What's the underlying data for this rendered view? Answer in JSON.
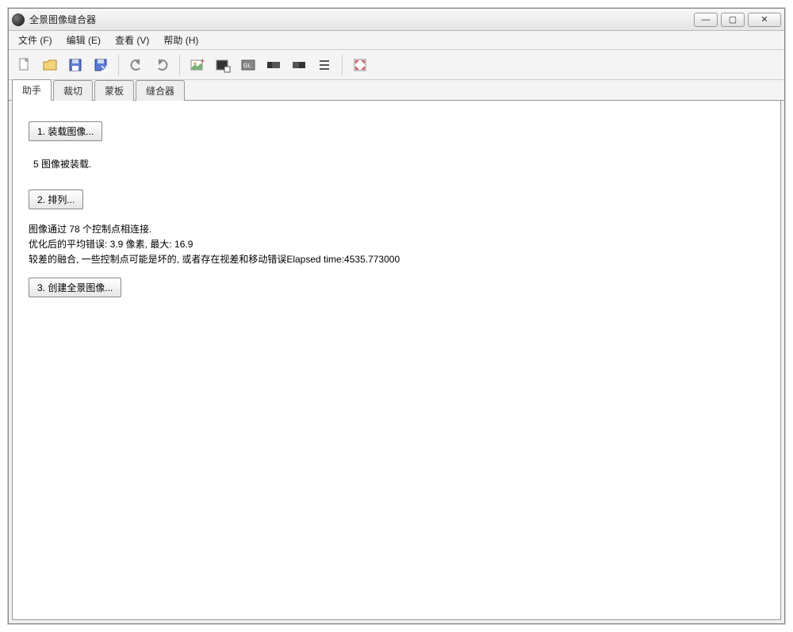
{
  "window": {
    "title": "全景图像缝合器"
  },
  "menu": {
    "file": "文件 (F)",
    "edit": "编辑 (E)",
    "view": "查看 (V)",
    "help": "帮助 (H)"
  },
  "tabs": {
    "assistant": "助手",
    "crop": "裁切",
    "mask": "蒙板",
    "stitcher": "缝合器"
  },
  "assistant": {
    "load_button": "1. 装载图像...",
    "loaded_status": "5 图像被装载.",
    "align_button": "2. 排列...",
    "align_line1": "图像通过 78 个控制点相连接.",
    "align_line2": "优化后的平均错误: 3.9 像素, 最大: 16.9",
    "align_line3": "较差的融合, 一些控制点可能是坏的, 或者存在视差和移动错误Elapsed time:4535.773000",
    "create_button": "3. 创建全景图像..."
  },
  "winbtns": {
    "min": "—",
    "max": "▢",
    "close": "✕"
  }
}
